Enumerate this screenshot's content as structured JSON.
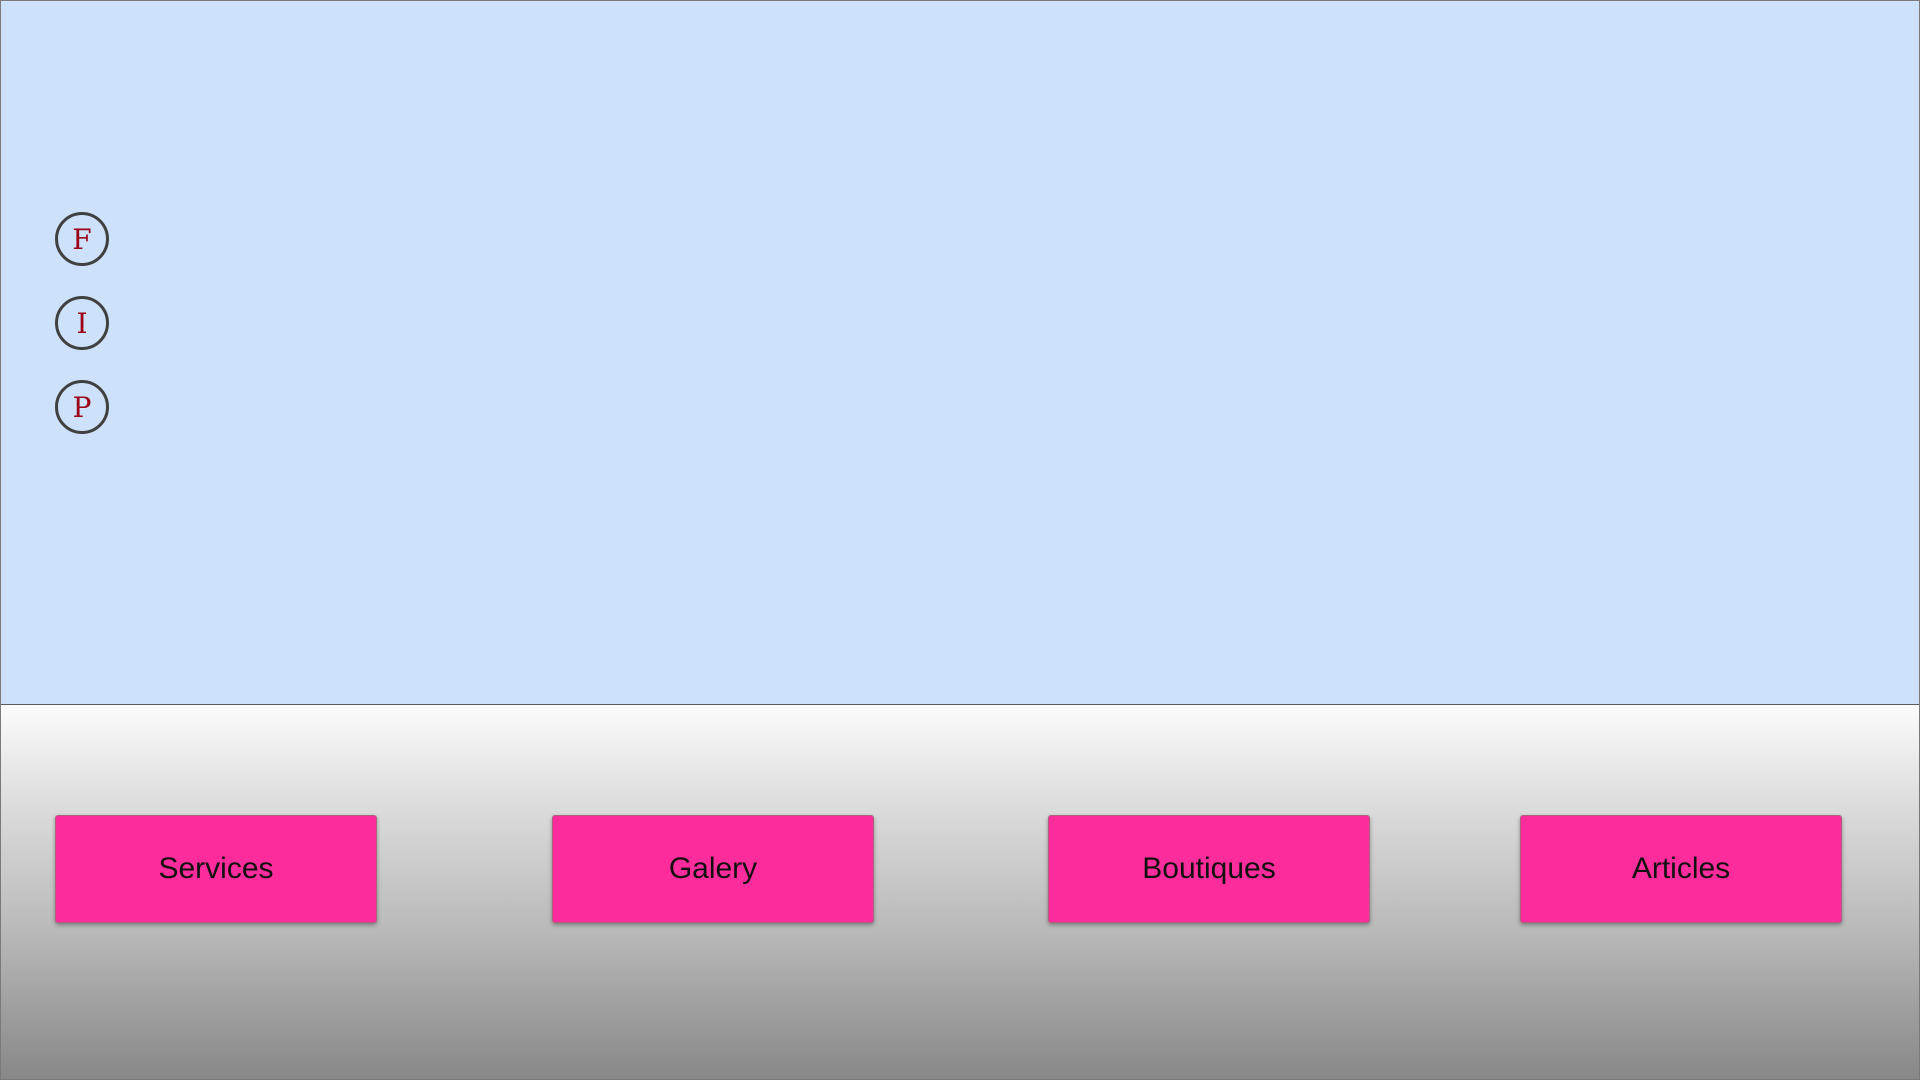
{
  "social": [
    {
      "letter": "F",
      "icon": "facebook-icon"
    },
    {
      "letter": "I",
      "icon": "instagram-icon"
    },
    {
      "letter": "P",
      "icon": "pinterest-icon"
    }
  ],
  "nav": [
    {
      "label": "Services"
    },
    {
      "label": "Galery"
    },
    {
      "label": "Boutiques"
    },
    {
      "label": "Articles"
    }
  ],
  "colors": {
    "hero_background": "#cde1fa",
    "button_background": "#fd2c9c",
    "social_letter": "#9c0016",
    "social_border": "#404040"
  }
}
